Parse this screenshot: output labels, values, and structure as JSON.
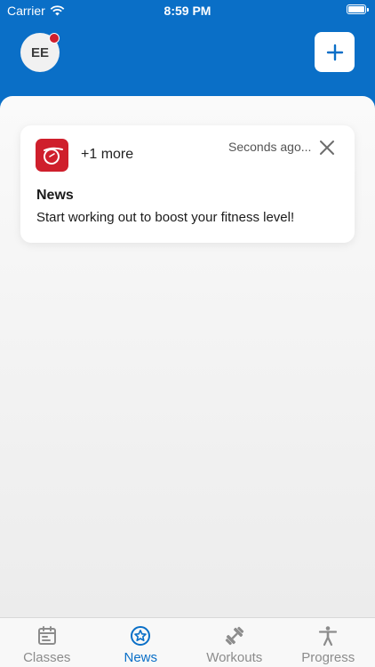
{
  "status_bar": {
    "carrier": "Carrier",
    "time": "8:59 PM",
    "battery_level": 1.0
  },
  "header": {
    "avatar_initials": "EE",
    "avatar_has_notification": true,
    "add_icon": "plus-icon"
  },
  "notification_card": {
    "app_icon": "app-logo-icon",
    "more_label": "+1 more",
    "time_ago": "Seconds ago...",
    "close_icon": "close-icon",
    "title": "News",
    "message": "Start working out to boost your fitness level!"
  },
  "tabs": [
    {
      "label": "Classes",
      "icon": "calendar-icon",
      "active": false
    },
    {
      "label": "News",
      "icon": "star-badge-icon",
      "active": true
    },
    {
      "label": "Workouts",
      "icon": "dumbbell-icon",
      "active": false
    },
    {
      "label": "Progress",
      "icon": "person-icon",
      "active": false
    }
  ],
  "colors": {
    "brand_blue": "#0a6fc7",
    "badge_red": "#d01f2e",
    "app_icon_red": "#cf1f2c",
    "inactive_tab": "#8c8c8c"
  }
}
